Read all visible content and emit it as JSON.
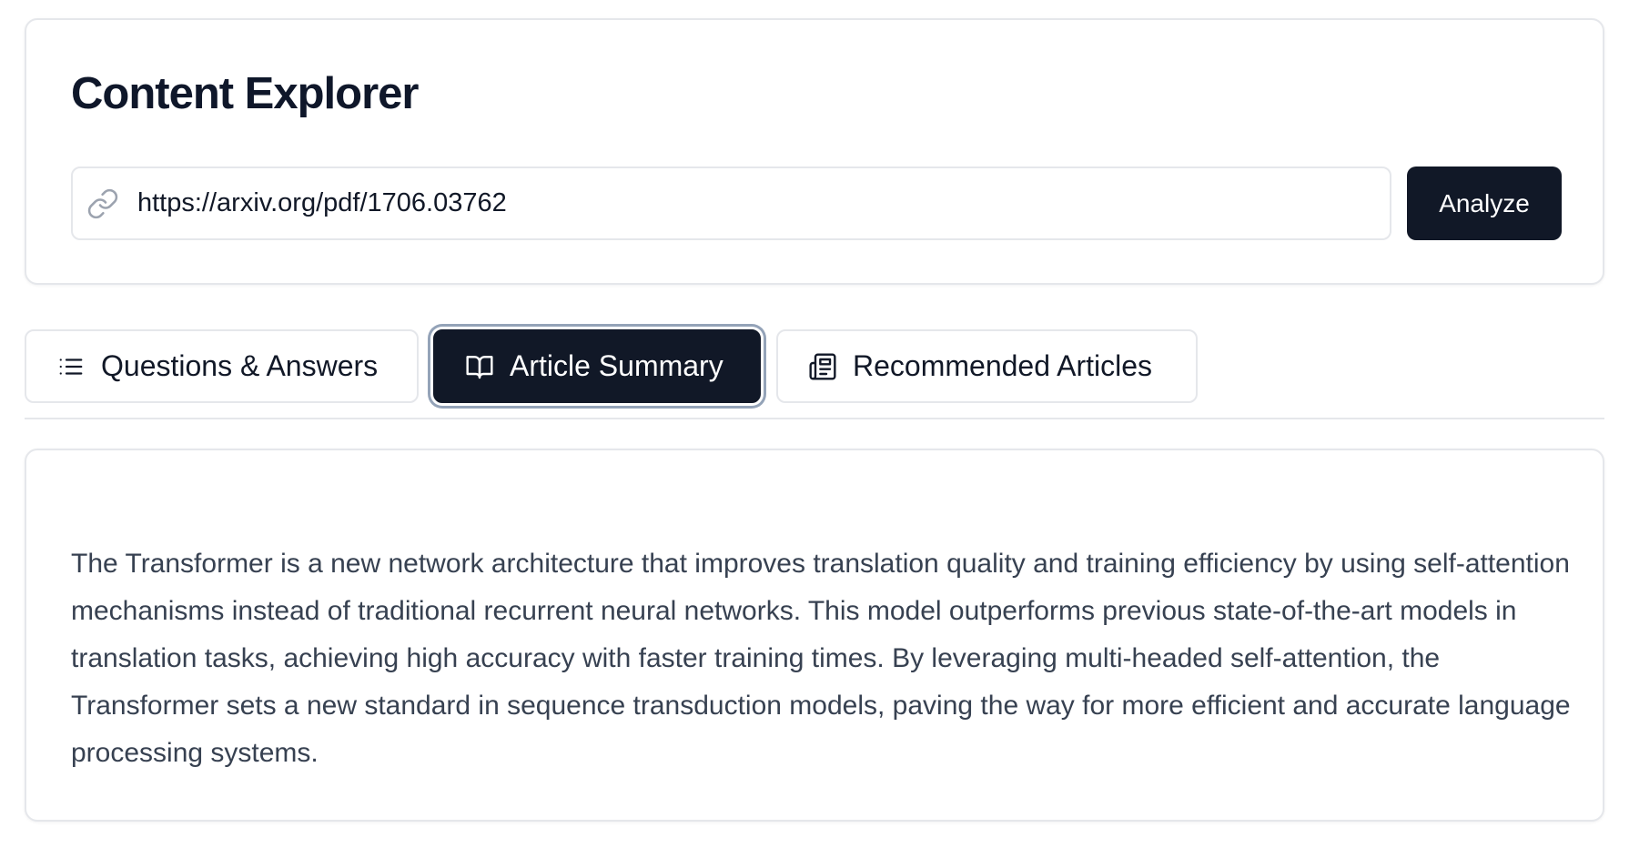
{
  "header": {
    "title": "Content Explorer",
    "url_input": {
      "value": "https://arxiv.org/pdf/1706.03762",
      "icon": "link-icon"
    },
    "analyze_button": "Analyze"
  },
  "tabs": [
    {
      "label": "Questions & Answers",
      "icon": "list-icon",
      "active": false
    },
    {
      "label": "Article Summary",
      "icon": "book-open-icon",
      "active": true
    },
    {
      "label": "Recommended Articles",
      "icon": "newspaper-icon",
      "active": false
    }
  ],
  "summary": {
    "text": "The Transformer is a new network architecture that improves translation quality and training efficiency by using self-attention mechanisms instead of traditional recurrent neural networks. This model outperforms previous state-of-the-art models in translation tasks, achieving high accuracy with faster training times. By leveraging multi-headed self-attention, the Transformer sets a new standard in sequence transduction models, paving the way for more efficient and accurate language processing systems."
  },
  "colors": {
    "primary": "#111827",
    "border": "#e5e7eb",
    "body_text": "#374151",
    "focus_ring": "#94a3b8",
    "background": "#ffffff"
  }
}
